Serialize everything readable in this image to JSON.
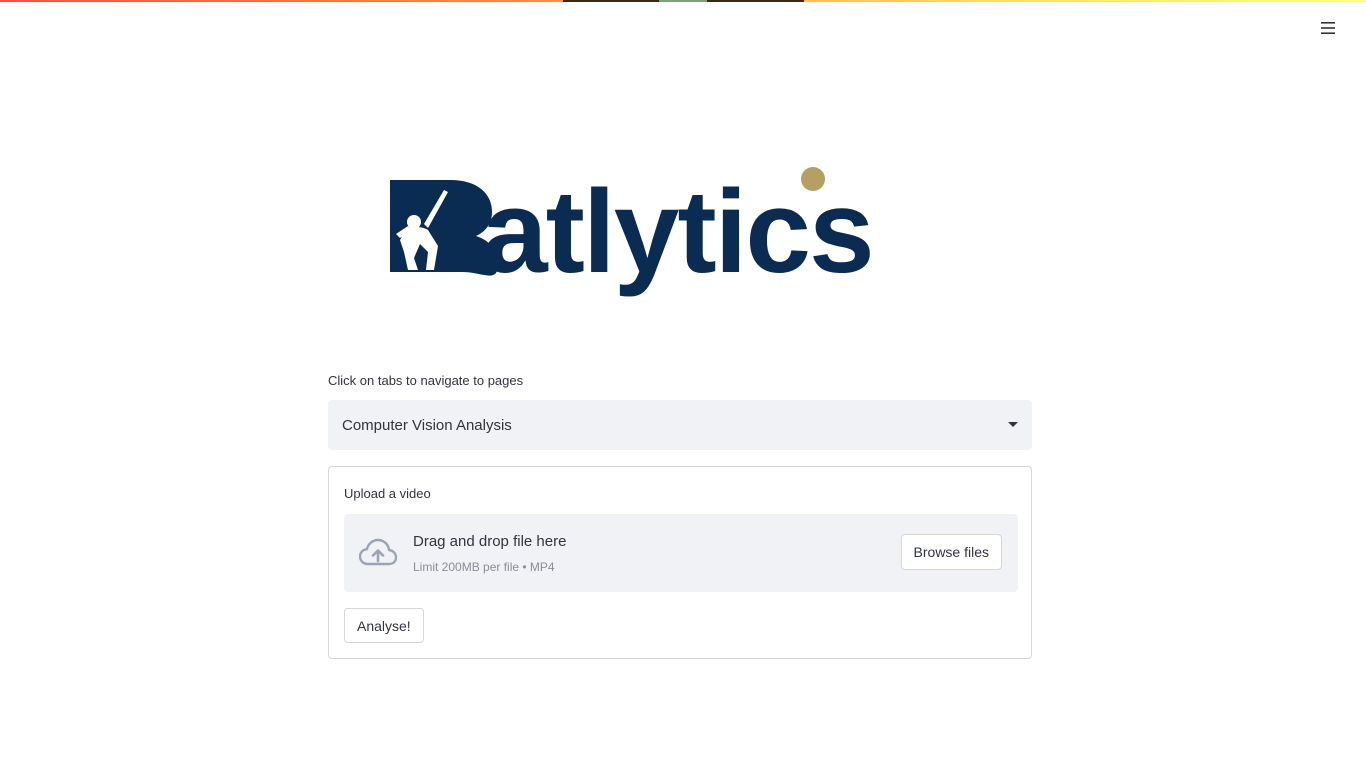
{
  "app": {
    "brand_text": "atlytics",
    "brand_initial": "B",
    "brand_color": "#0a2b52",
    "brand_accent_color": "#b59f62"
  },
  "header": {
    "menu_icon": "hamburger-icon"
  },
  "navigation": {
    "label": "Click on tabs to navigate to pages",
    "selected_page": "Computer Vision Analysis",
    "dropdown_icon": "caret-down-icon"
  },
  "uploader": {
    "label": "Upload a video",
    "icon": "cloud-upload-icon",
    "title": "Drag and drop file here",
    "hint": "Limit 200MB per file • MP4",
    "browse_label": "Browse files"
  },
  "actions": {
    "analyse_label": "Analyse!"
  }
}
